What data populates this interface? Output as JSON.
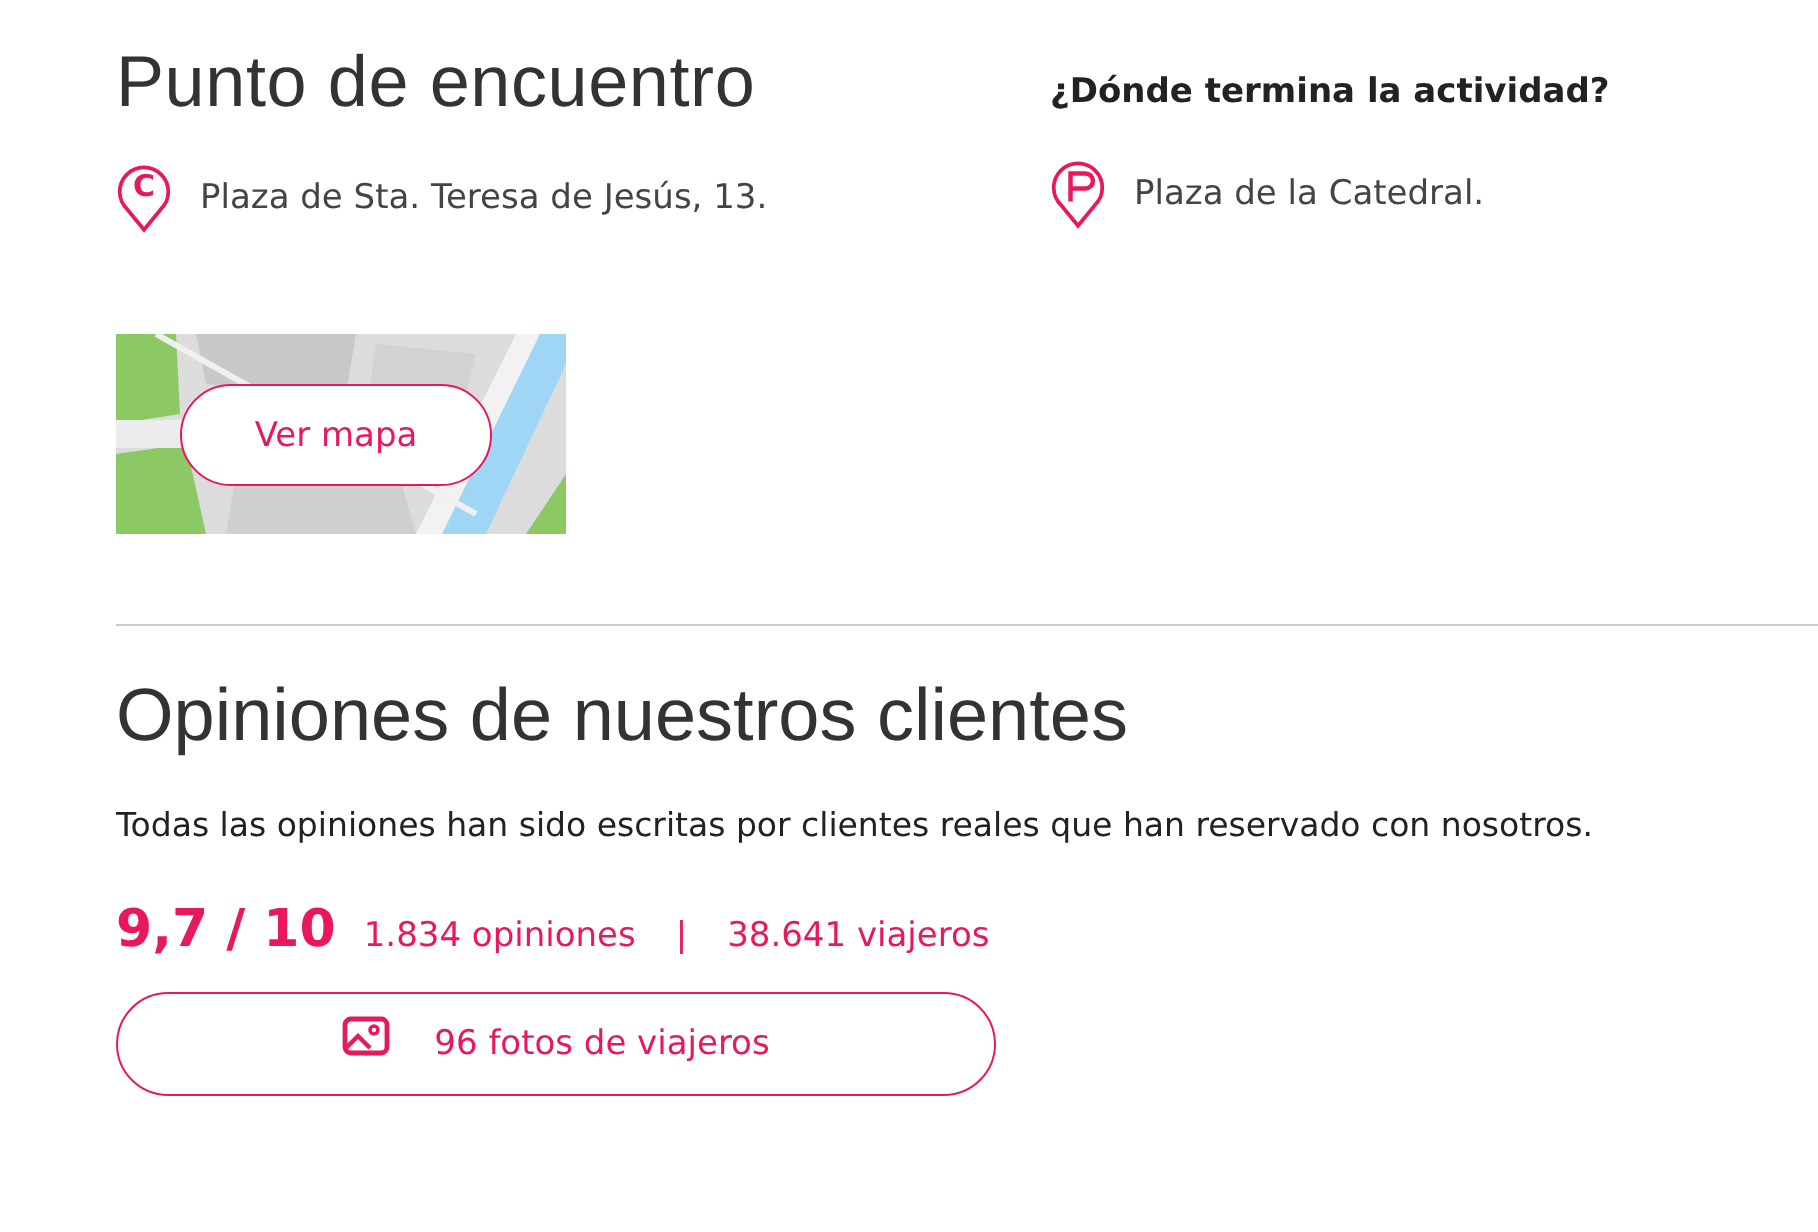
{
  "meeting_point": {
    "title": "Punto de encuentro",
    "address": "Plaza de Sta. Teresa de Jesús, 13.",
    "pin_letter": "C",
    "map_button": "Ver mapa"
  },
  "end_point": {
    "title": "¿Dónde termina la actividad?",
    "address": "Plaza de la Catedral."
  },
  "reviews": {
    "title": "Opiniones de nuestros clientes",
    "description": "Todas las opiniones han sido escritas por clientes reales que han reservado con nosotros.",
    "score": "9,7 / 10",
    "review_count": "1.834 opiniones",
    "separator": "|",
    "travelers": "38.641 viajeros",
    "photos_button": "96 fotos de viajeros"
  }
}
